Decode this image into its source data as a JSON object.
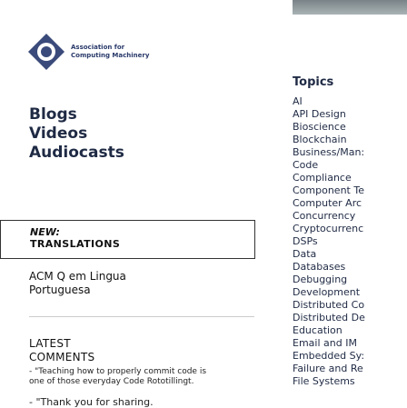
{
  "logo": {
    "line1": "Association for",
    "line2": "Computing Machinery"
  },
  "nav": [
    "Blogs",
    "Videos",
    "Audiocasts"
  ],
  "box": {
    "new": "NEW:",
    "translations": "TRANSLATIONS"
  },
  "acm_lingua": [
    "ACM Q em Lingua",
    "Portuguesa"
  ],
  "latest": [
    "LATEST",
    "COMMENTS"
  ],
  "quote1": "- \"Teaching how to properly commit code is one of those everyday Code Rototillingt.",
  "quote2": "- \"Thank you for sharing.",
  "topics_title": "Topics",
  "topics": [
    "AI",
    "API Design",
    "Bioscience",
    "Blockchain",
    "Business/Man:",
    "Code",
    "Compliance",
    "Component Te",
    "Computer Arc",
    "Concurrency",
    "Cryptocurrenc",
    "DSPs",
    "Data",
    "Databases",
    "Debugging",
    "Development",
    "Distributed Co",
    "Distributed De",
    "Education",
    "Email and IM",
    "Embedded Sy:",
    "Failure and Re",
    "File Systems"
  ],
  "colors": {
    "nav_text": "#1f2a44",
    "banner": "#8c9698"
  }
}
